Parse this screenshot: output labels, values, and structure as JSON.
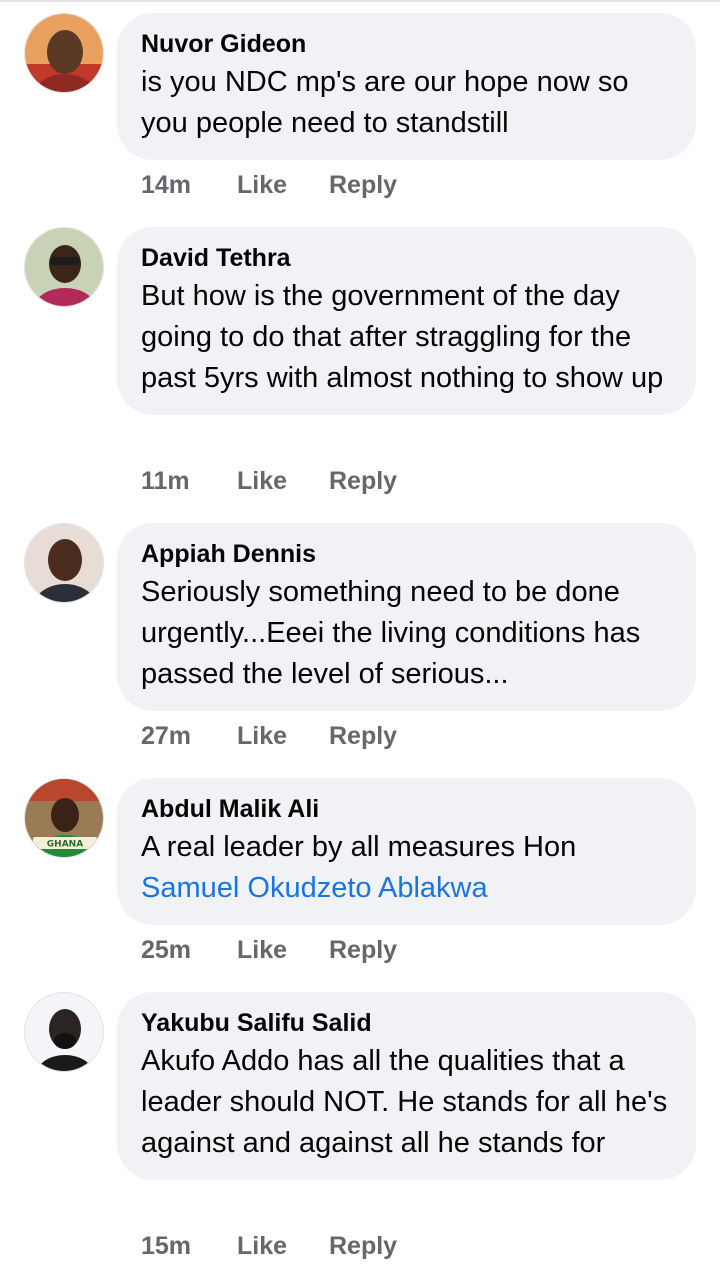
{
  "comments": [
    {
      "author": "Nuvor Gideon",
      "text": "is you NDC mp's are our hope now so you people need to standstill",
      "time": "14m",
      "like_label": "Like",
      "reply_label": "Reply",
      "avatar_colors": [
        "#e9a15f",
        "#5a3a25"
      ]
    },
    {
      "author": "David Tethra",
      "text": "But how is the government of the day going to do that after straggling for the past 5yrs with almost nothing to show up",
      "time": "11m",
      "like_label": "Like",
      "reply_label": "Reply",
      "avatar_colors": [
        "#c8d3b6",
        "#b22a5a"
      ]
    },
    {
      "author": "Appiah Dennis",
      "text": "Seriously something need to be done urgently...Eeei the living conditions has passed the level of serious...",
      "time": "27m",
      "like_label": "Like",
      "reply_label": "Reply",
      "avatar_colors": [
        "#e7dcd6",
        "#2c2f3a"
      ]
    },
    {
      "author": "Abdul Malik Ali",
      "text_before": "A real leader by all measures Hon ",
      "mention": "Samuel Okudzeto Ablakwa",
      "time": "25m",
      "like_label": "Like",
      "reply_label": "Reply",
      "avatar_badge": "GHANA",
      "avatar_colors": [
        "#9a7b53",
        "#1f8a3a"
      ]
    },
    {
      "author": "Yakubu Salifu Salid",
      "text": "Akufo Addo has all the qualities that a leader should NOT. He stands for all he's against and against all he stands for",
      "time": "15m",
      "like_label": "Like",
      "reply_label": "Reply",
      "avatar_colors": [
        "#f3f5f8",
        "#2a2522"
      ]
    }
  ]
}
